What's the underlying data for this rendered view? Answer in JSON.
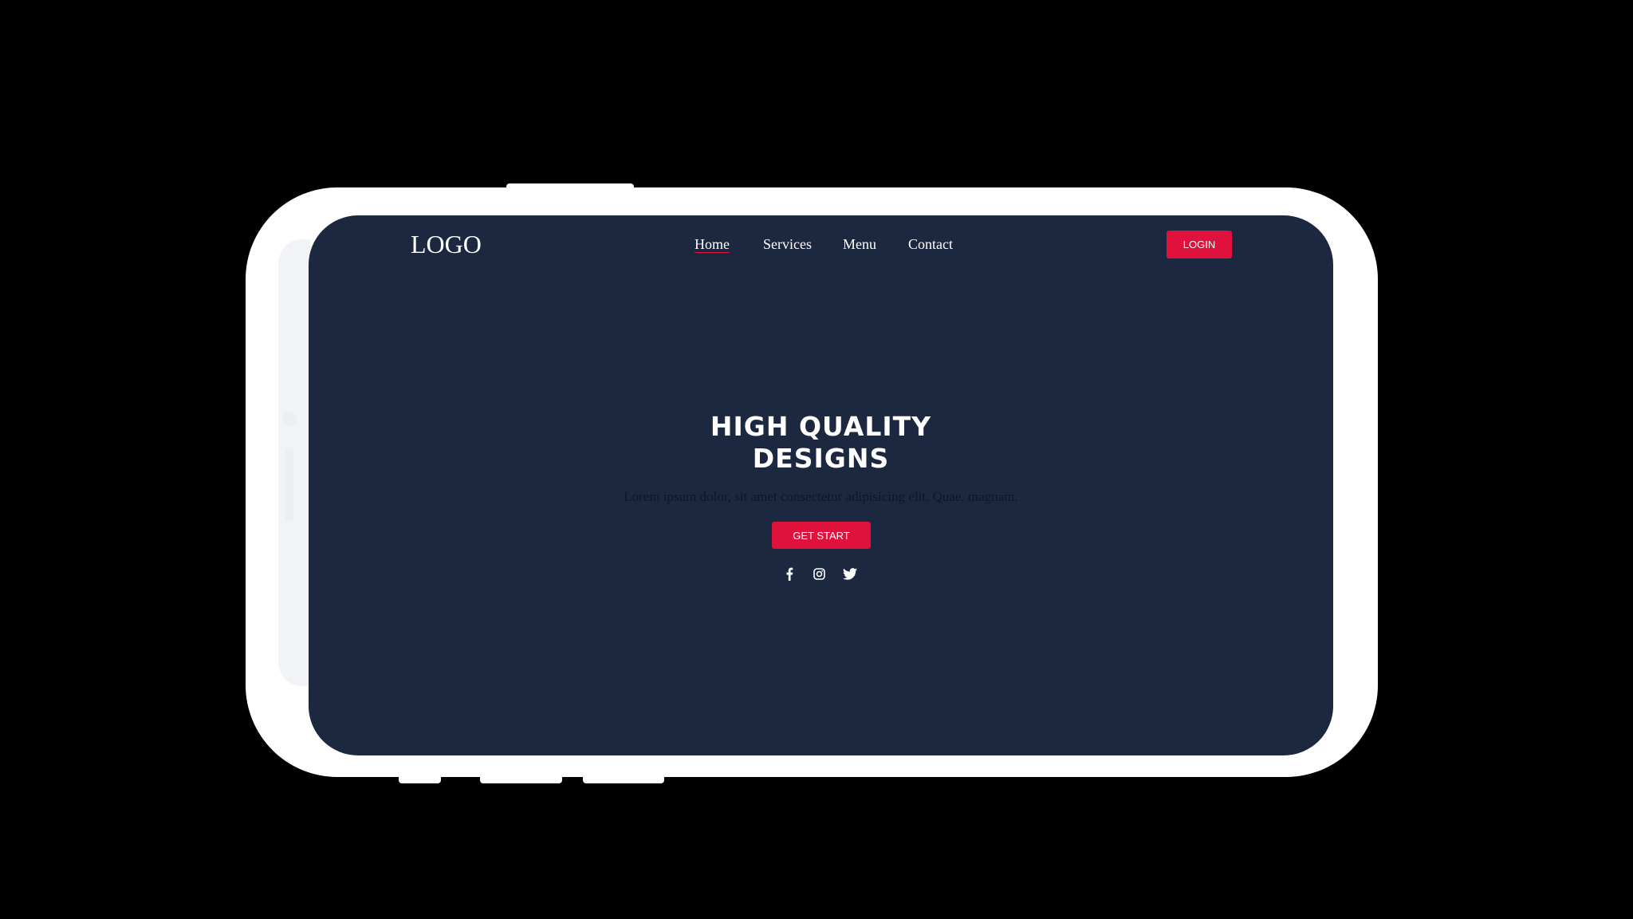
{
  "header": {
    "logo": "LOGO",
    "nav": [
      {
        "label": "Home",
        "active": true
      },
      {
        "label": "Services"
      },
      {
        "label": "Menu"
      },
      {
        "label": "Contact"
      }
    ],
    "login_label": "LOGIN"
  },
  "hero": {
    "title_line1": "HIGH QUALITY",
    "title_line2": "DESIGNS",
    "subtitle": "Lorem ipsum dolor, sit amet consectetur adipisicing elit. Quae, magnam.",
    "cta_label": "GET START",
    "social_icons": [
      "facebook-icon",
      "instagram-icon",
      "twitter-icon"
    ]
  },
  "colors": {
    "background": "#1c2840",
    "accent": "#e0113d"
  }
}
